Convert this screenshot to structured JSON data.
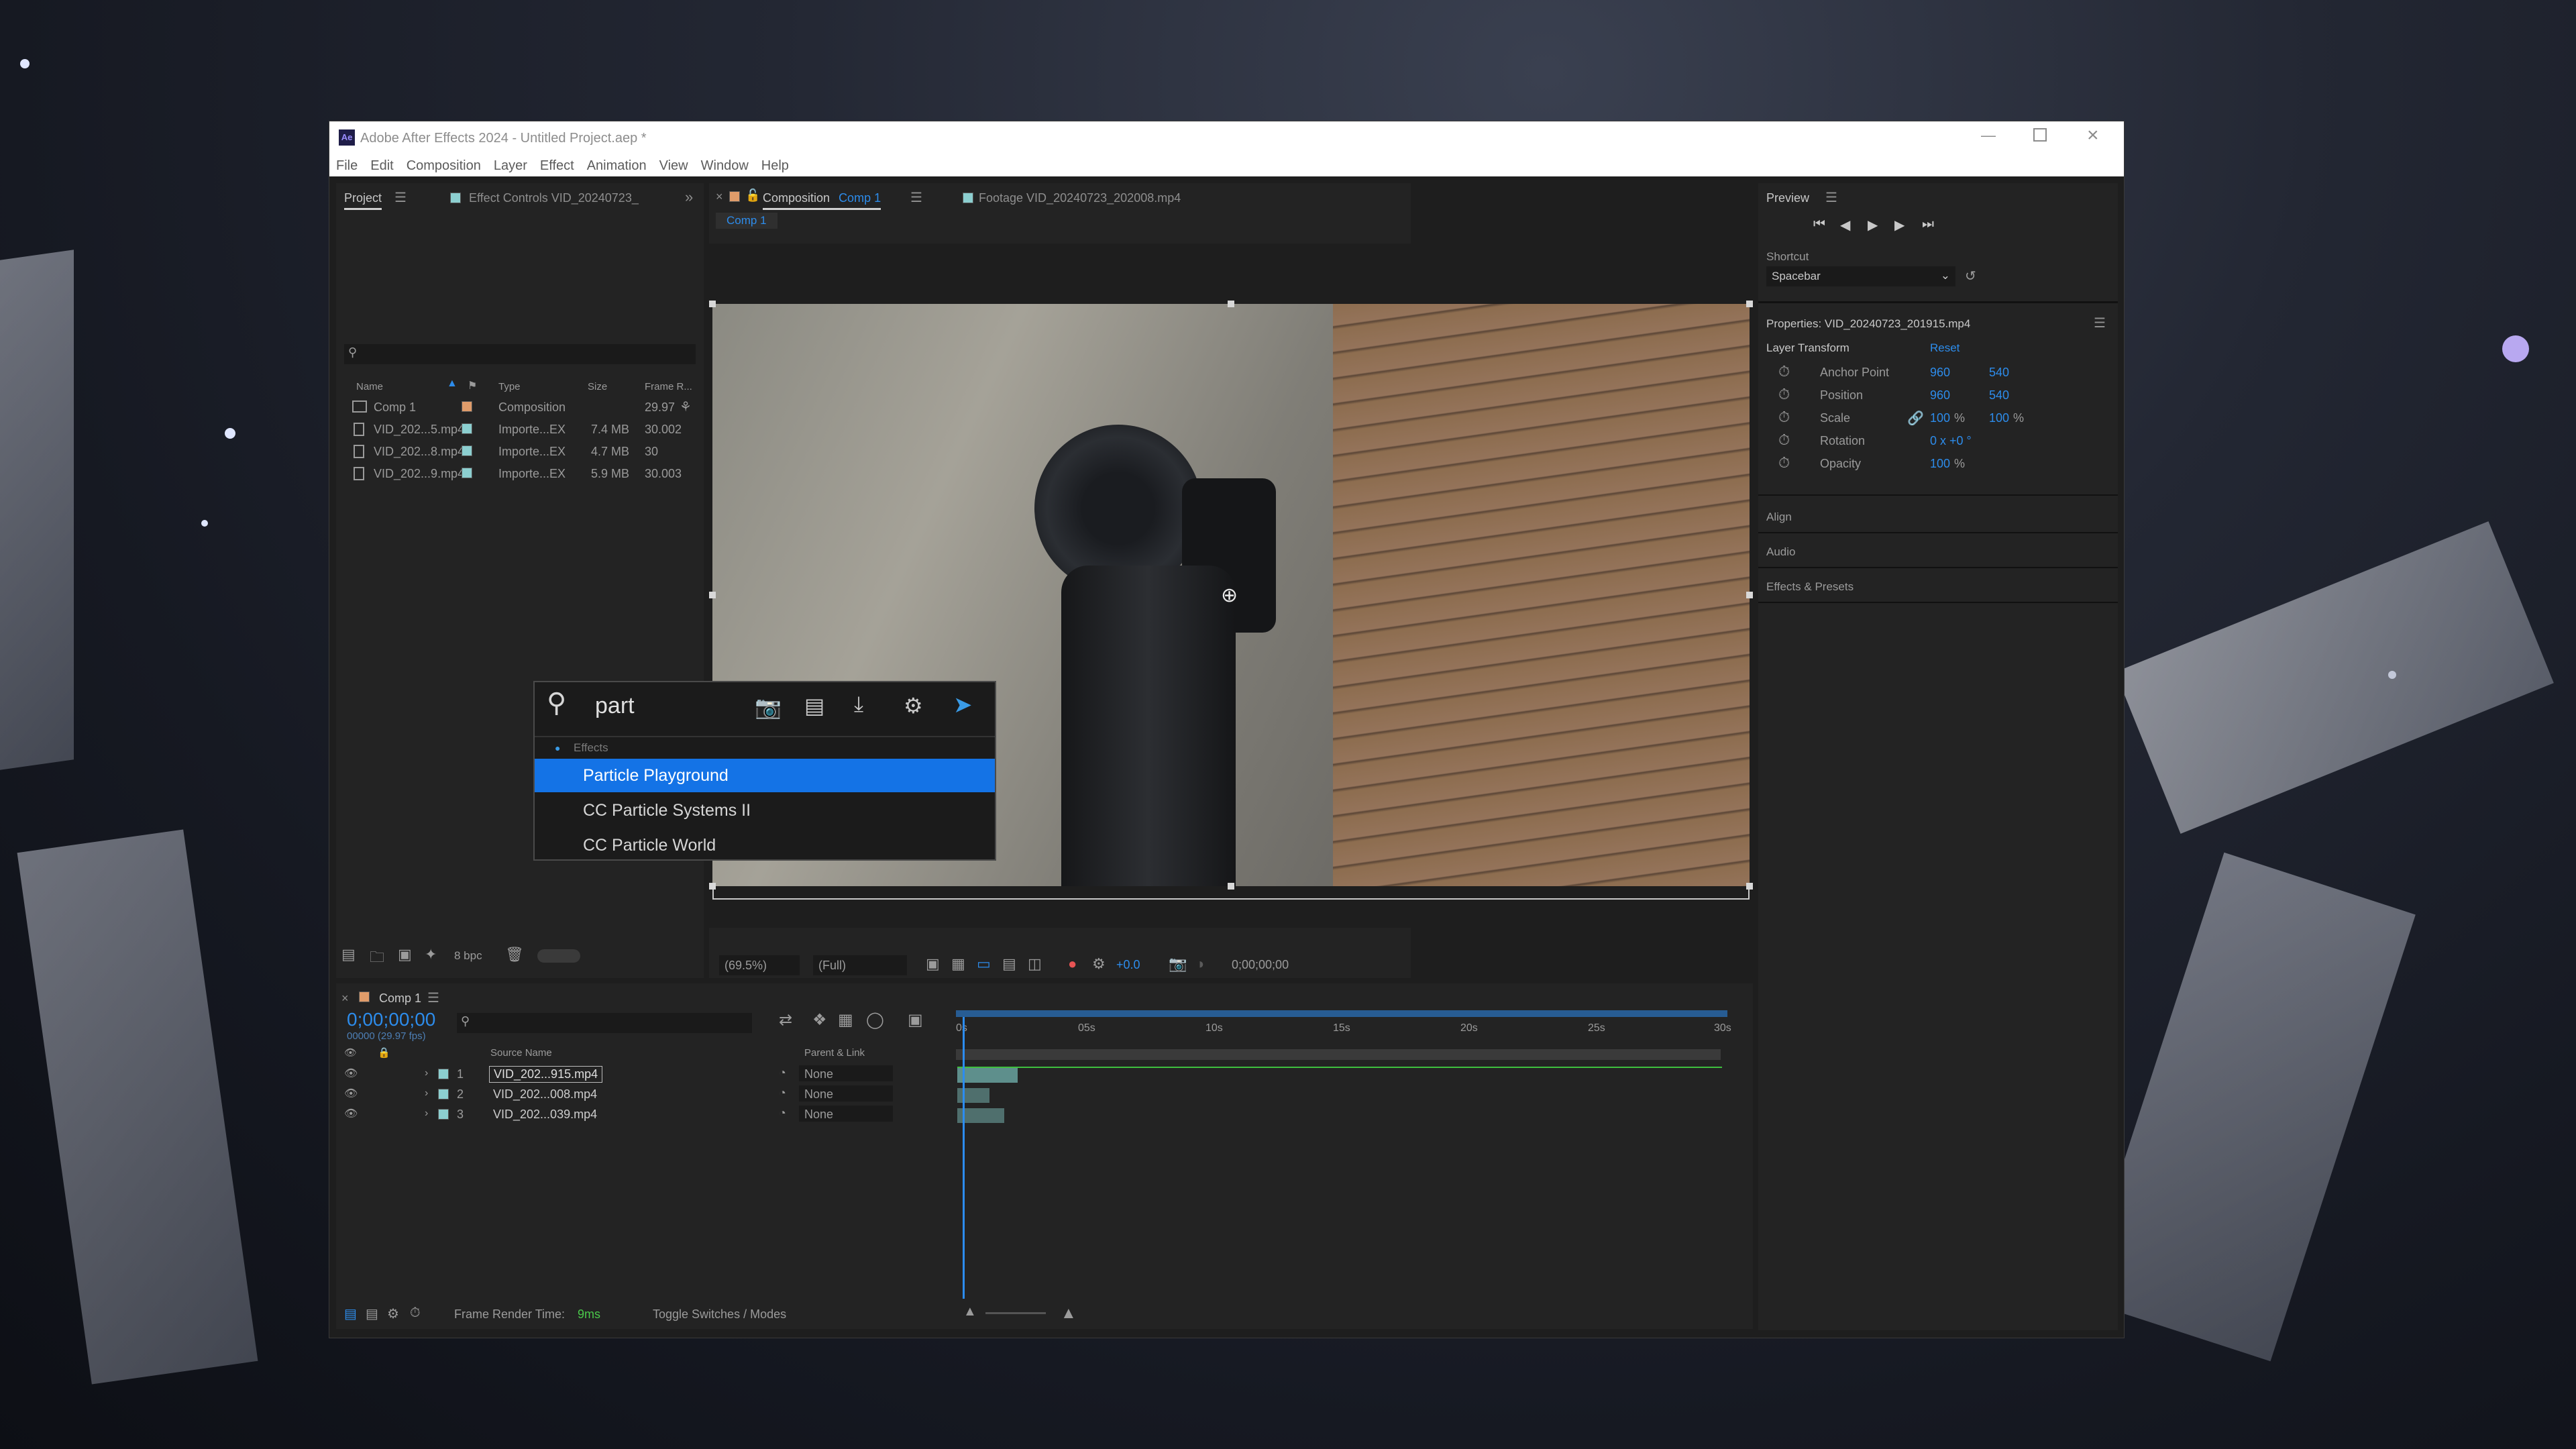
{
  "window": {
    "app_icon": "Ae",
    "title": "Adobe After Effects 2024 - Untitled Project.aep *"
  },
  "menu": [
    "File",
    "Edit",
    "Composition",
    "Layer",
    "Effect",
    "Animation",
    "View",
    "Window",
    "Help"
  ],
  "project_panel": {
    "tab_project": "Project",
    "tab_effect_controls": "Effect Controls VID_20240723_",
    "search_placeholder": "",
    "columns": [
      "Name",
      "Type",
      "Size",
      "Frame R..."
    ],
    "items": [
      {
        "name": "Comp 1",
        "type": "Composition",
        "size": "",
        "frame_rate": "29.97"
      },
      {
        "name": "VID_202...5.mp4",
        "type": "Importe...EX",
        "size": "7.4 MB",
        "frame_rate": "30.002"
      },
      {
        "name": "VID_202...8.mp4",
        "type": "Importe...EX",
        "size": "4.7 MB",
        "frame_rate": "30"
      },
      {
        "name": "VID_202...9.mp4",
        "type": "Importe...EX",
        "size": "5.9 MB",
        "frame_rate": "30.003"
      }
    ],
    "bpc": "8 bpc"
  },
  "comp_panel": {
    "tab_composition": "Composition",
    "tab_comp_name": "Comp 1",
    "tab_footage": "Footage VID_20240723_202008.mp4",
    "sub_tab": "Comp 1",
    "zoom": "(69.5%)",
    "resolution": "(Full)",
    "exposure": "+0.0",
    "timecode": "0;00;00;00"
  },
  "search_popup": {
    "query": "part",
    "section": "Effects",
    "results": [
      "Particle Playground",
      "CC Particle Systems II",
      "CC Particle World"
    ]
  },
  "preview_panel": {
    "title": "Preview",
    "shortcut_label": "Shortcut",
    "shortcut_value": "Spacebar"
  },
  "properties_panel": {
    "title": "Properties: VID_20240723_201915.mp4",
    "section": "Layer Transform",
    "reset": "Reset",
    "props": [
      {
        "name": "Anchor Point",
        "v1": "960",
        "v2": "540"
      },
      {
        "name": "Position",
        "v1": "960",
        "v2": "540"
      },
      {
        "name": "Scale",
        "v1": "100",
        "u1": "%",
        "v2": "100",
        "u2": "%"
      },
      {
        "name": "Rotation",
        "v1": "0 x +0 °",
        "v2": ""
      },
      {
        "name": "Opacity",
        "v1": "100",
        "u1": "%",
        "v2": ""
      }
    ],
    "collapsed": [
      "Align",
      "Audio",
      "Effects & Presets"
    ]
  },
  "timeline": {
    "tab": "Comp 1",
    "timecode": "0;00;00;00",
    "fps": "00000 (29.97 fps)",
    "col_source": "Source Name",
    "col_parent": "Parent & Link",
    "ruler": [
      "0s",
      "05s",
      "10s",
      "15s",
      "20s",
      "25s",
      "30s"
    ],
    "layers": [
      {
        "num": "1",
        "name": "VID_202...915.mp4",
        "parent": "None"
      },
      {
        "num": "2",
        "name": "VID_202...008.mp4",
        "parent": "None"
      },
      {
        "num": "3",
        "name": "VID_202...039.mp4",
        "parent": "None"
      }
    ],
    "render_time_label": "Frame Render Time:",
    "render_time": "9ms",
    "toggle": "Toggle Switches / Modes"
  },
  "colors": {
    "accent": "#2d8ceb",
    "selection": "#1473e6",
    "label_teal": "#8ccfd0",
    "work_area": "#2c8cf0"
  }
}
